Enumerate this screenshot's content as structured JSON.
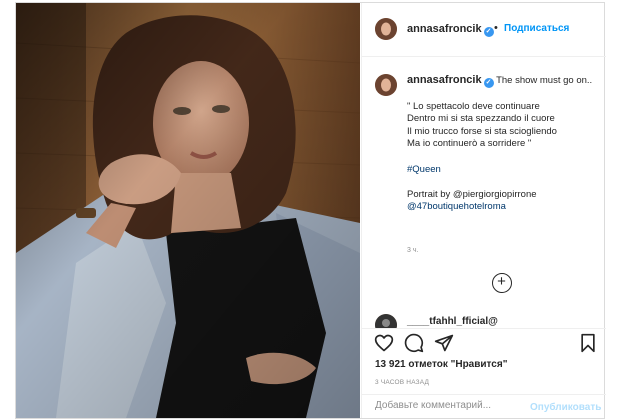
{
  "post": {
    "username": "annasafroncik",
    "verified_mark": "✓",
    "follow_label": "Подписаться",
    "separator": "•",
    "caption_lines": [
      "The show must go on..",
      "",
      "\" Lo spettacolo deve continuare",
      "Dentro mi si sta spezzando il cuore",
      "Il mio trucco forse si sta sciogliendo",
      "Ma io continuerò a sorridere \"",
      "",
      "#Queen",
      "",
      "Portrait by @piergiorgiopirrone",
      "@47boutiquehotelroma"
    ],
    "caption_time": "3 ч.",
    "load_more_symbol": "+",
    "next_comment_user": "____tfahhl_fficial@",
    "likes_text": "13 921 отметок \"Нравится\"",
    "time_ago": "3 ЧАСОВ НАЗАД",
    "comment_placeholder": "Добавьте комментарий...",
    "publish_label": "Опубликовать"
  },
  "icons": {
    "like": "heart-icon",
    "comment": "comment-icon",
    "share": "paper-plane-icon",
    "save": "bookmark-icon",
    "load_more": "plus-circle-icon"
  },
  "colors": {
    "link_blue": "#0095f6",
    "verified_blue": "#3897f0",
    "hashtag": "#00376b",
    "muted": "#8e8e8e",
    "publish_disabled": "#b2dffc",
    "border": "#dbdbdb"
  }
}
